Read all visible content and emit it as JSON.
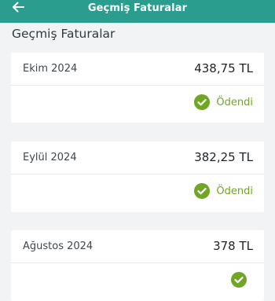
{
  "appbar": {
    "title": "Geçmiş Faturalar",
    "back_icon": "arrow-left-icon"
  },
  "section": {
    "title": "Geçmiş Faturalar"
  },
  "colors": {
    "appbar": "#2a9d8f",
    "paid": "#6fa623"
  },
  "invoices": [
    {
      "month": "Ekim 2024",
      "amount": "438,75 TL",
      "status": "Ödendi"
    },
    {
      "month": "Eylül 2024",
      "amount": "382,25 TL",
      "status": "Ödendi"
    },
    {
      "month": "Ağustos 2024",
      "amount": "378 TL",
      "status": ""
    }
  ]
}
